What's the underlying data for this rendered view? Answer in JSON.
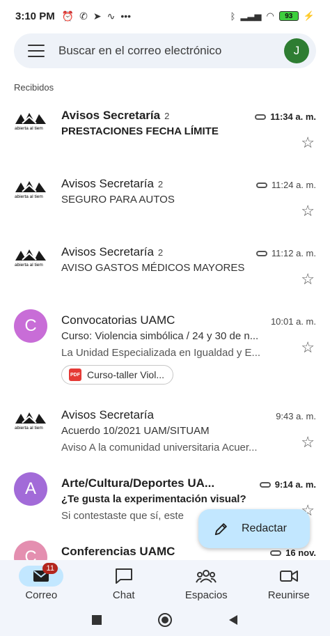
{
  "status_bar": {
    "time": "3:10 PM",
    "left_icons": [
      "alarm-icon",
      "whatsapp-icon",
      "telegram-icon",
      "activity-icon",
      "more-icon"
    ],
    "battery": "93",
    "right_icons": [
      "bluetooth-icon",
      "signal-icon",
      "wifi-icon",
      "battery-icon",
      "charging-icon"
    ]
  },
  "search": {
    "placeholder": "Buscar en el correo electrónico",
    "avatar_letter": "J",
    "avatar_color": "#2e7d32"
  },
  "section_label": "Recibidos",
  "emails": [
    {
      "sender": "Avisos Secretaría",
      "count": "2",
      "time": "11:34 a. m.",
      "subject": "PRESTACIONES FECHA LÍMITE",
      "snippet": "",
      "unread": true,
      "attachment_icon": true,
      "avatar_type": "logo",
      "logo_text": "abierta al tiem"
    },
    {
      "sender": "Avisos Secretaría",
      "count": "2",
      "time": "11:24 a. m.",
      "subject": "SEGURO PARA AUTOS",
      "snippet": "",
      "unread": false,
      "attachment_icon": true,
      "avatar_type": "logo",
      "logo_text": "abierta al tiem"
    },
    {
      "sender": "Avisos Secretaría",
      "count": "2",
      "time": "11:12 a. m.",
      "subject": "AVISO GASTOS MÉDICOS MAYORES",
      "snippet": "",
      "unread": false,
      "attachment_icon": true,
      "avatar_type": "logo",
      "logo_text": "abierta al tiem"
    },
    {
      "sender": "Convocatorias UAMC",
      "count": "",
      "time": "10:01 a. m.",
      "subject": "Curso: Violencia simbólica / 24 y 30 de n...",
      "snippet": "La Unidad Especializada en Igualdad y E...",
      "unread": false,
      "attachment_icon": false,
      "avatar_type": "letter",
      "avatar_letter": "C",
      "avatar_color": "#c86dd7",
      "chip": "Curso-taller Viol...",
      "chip_icon": "PDF"
    },
    {
      "sender": "Avisos Secretaría",
      "count": "",
      "time": "9:43 a. m.",
      "subject": "Acuerdo 10/2021 UAM/SITUAM",
      "snippet": "Aviso A la comunidad universitaria Acuer...",
      "unread": false,
      "attachment_icon": false,
      "avatar_type": "logo",
      "logo_text": "abierta al tiem"
    },
    {
      "sender": "Arte/Cultura/Deportes UA...",
      "count": "",
      "time": "9:14 a. m.",
      "subject": "¿Te gusta la experimentación visual?",
      "snippet": "Si contestaste que sí, este",
      "unread": true,
      "attachment_icon": true,
      "avatar_type": "letter",
      "avatar_letter": "A",
      "avatar_color": "#a26bd8"
    },
    {
      "sender": "Conferencias UAMC",
      "count": "",
      "time": "16 nov.",
      "subject": "",
      "snippet": "",
      "unread": true,
      "attachment_icon": true,
      "avatar_type": "letter",
      "avatar_letter": "C",
      "avatar_color": "#e48fb0"
    }
  ],
  "compose": {
    "label": "Redactar"
  },
  "bottom_nav": [
    {
      "label": "Correo",
      "icon": "mail-icon",
      "badge": "11",
      "active": true
    },
    {
      "label": "Chat",
      "icon": "chat-icon",
      "badge": "",
      "active": false
    },
    {
      "label": "Espacios",
      "icon": "spaces-icon",
      "badge": "",
      "active": false
    },
    {
      "label": "Reunirse",
      "icon": "video-icon",
      "badge": "",
      "active": false
    }
  ],
  "system_nav": [
    "recents-icon",
    "home-icon",
    "back-icon"
  ]
}
